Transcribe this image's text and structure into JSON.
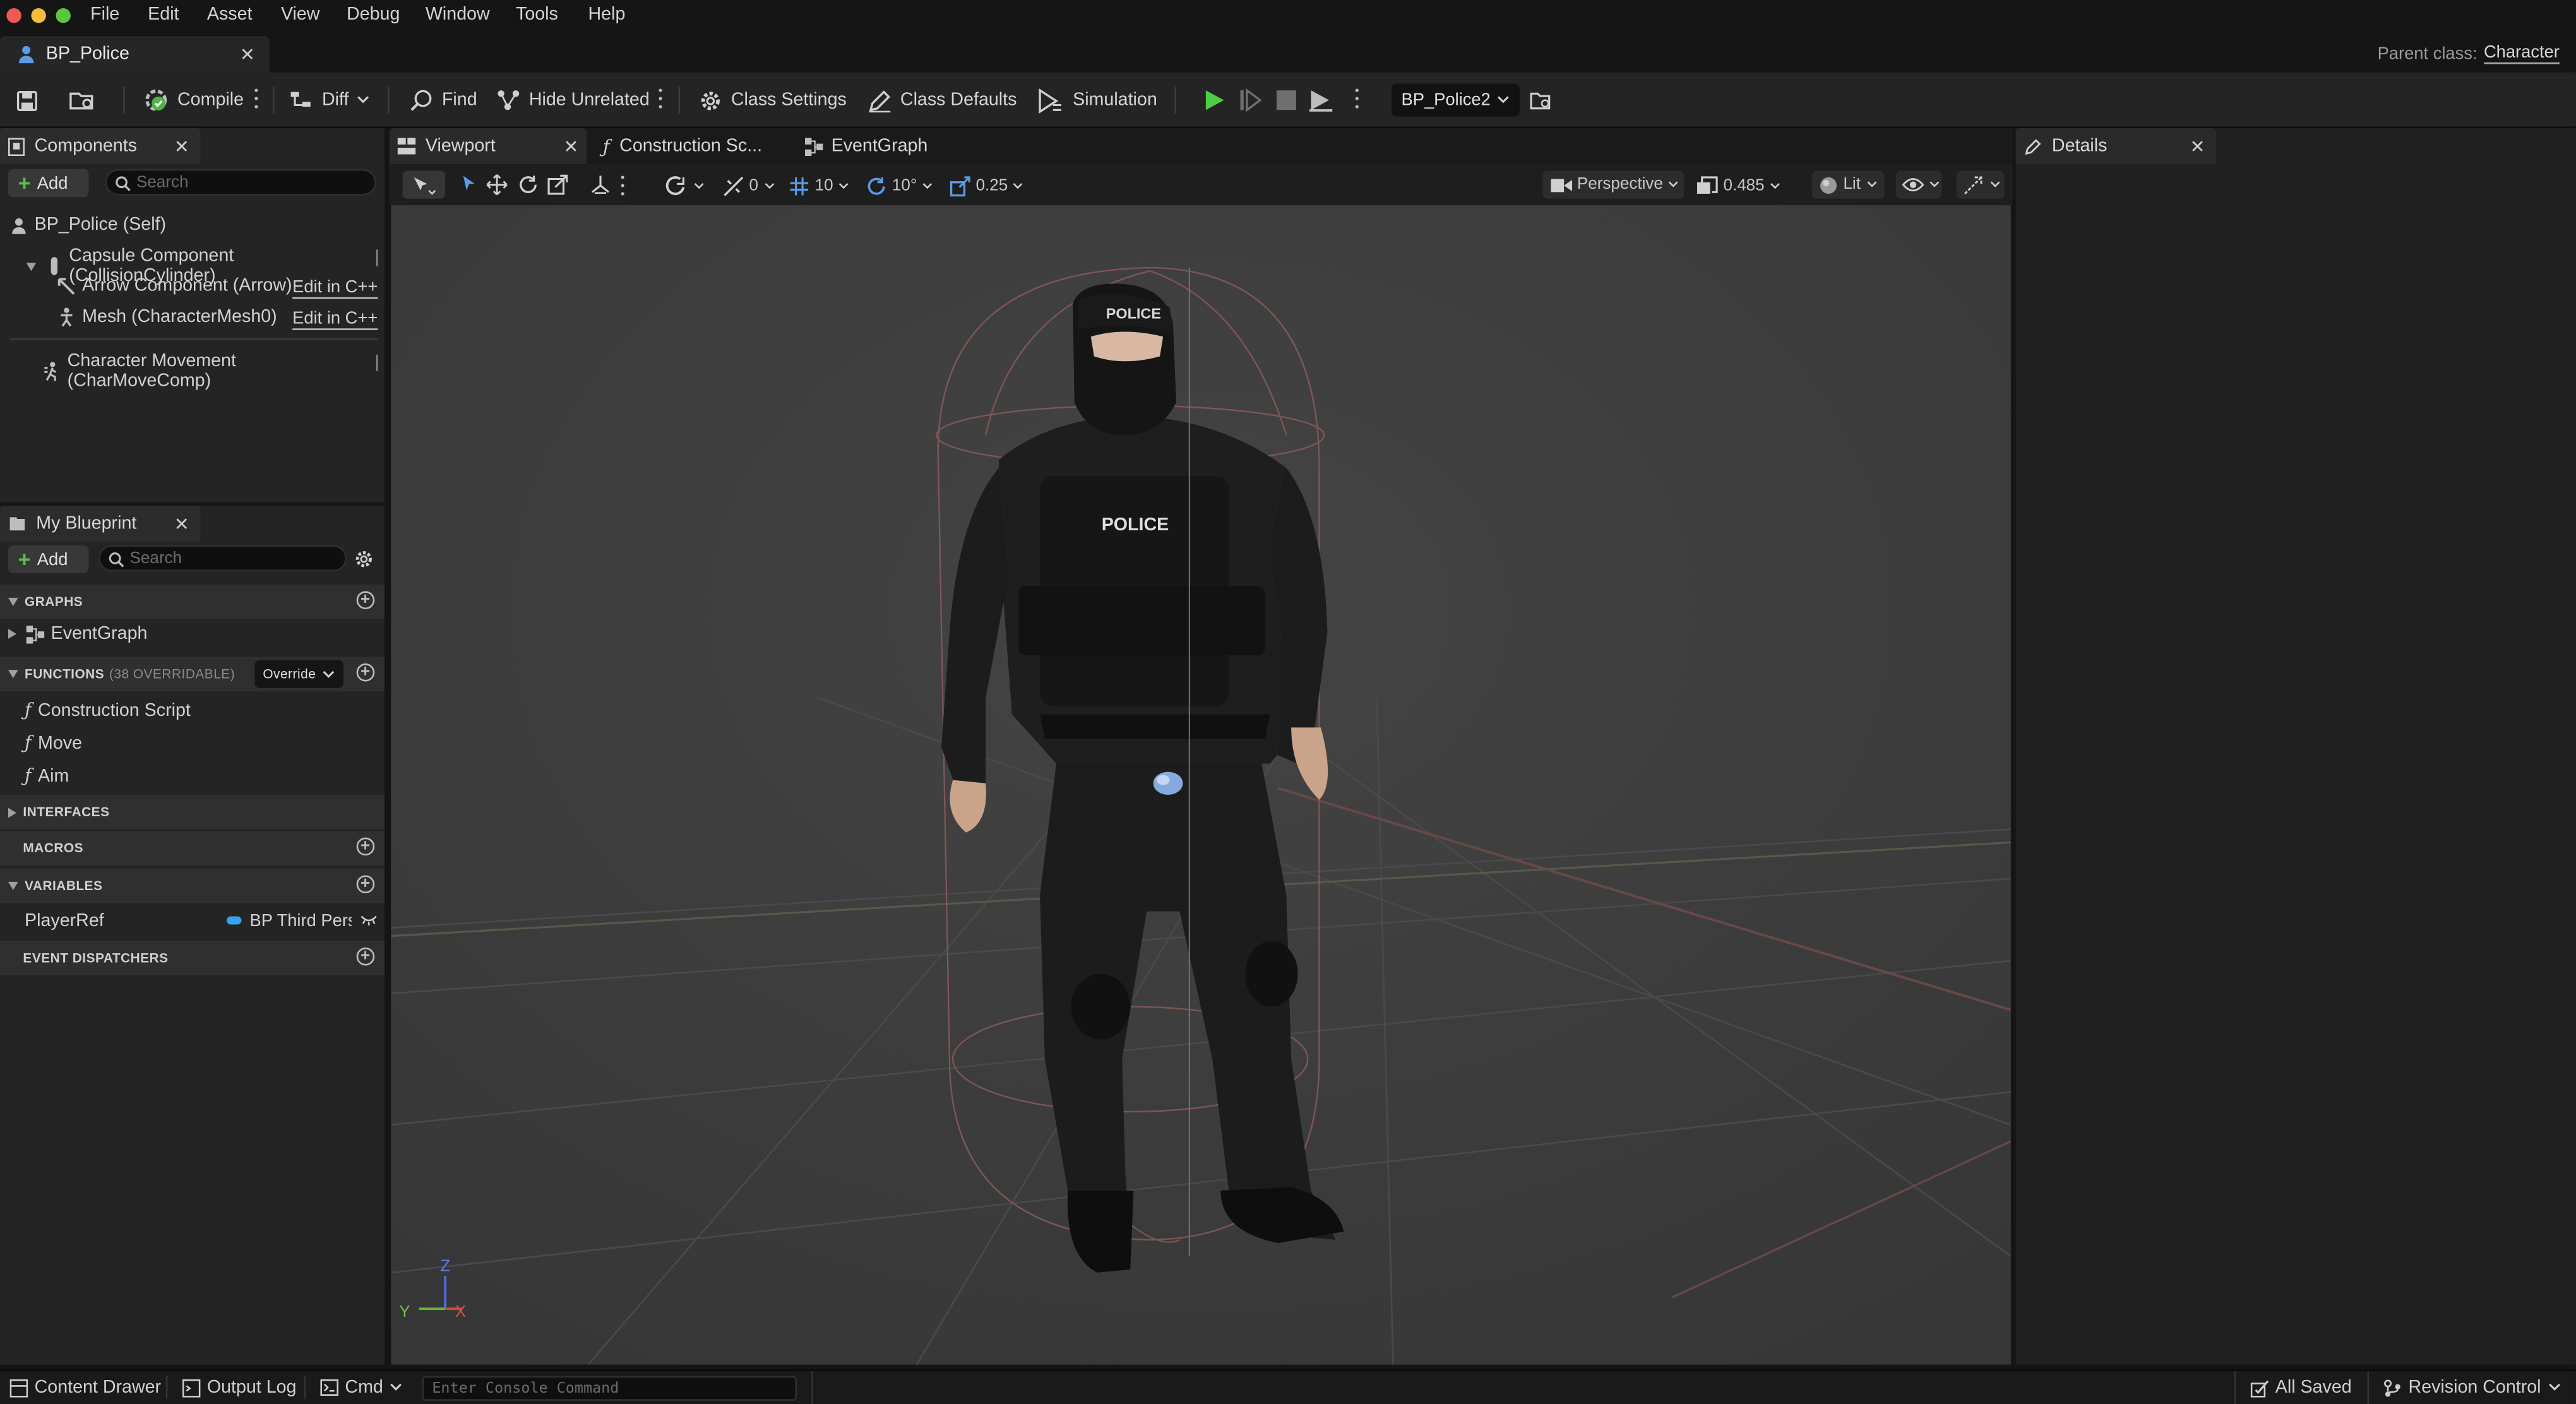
{
  "menu": [
    "File",
    "Edit",
    "Asset",
    "View",
    "Debug",
    "Window",
    "Tools",
    "Help"
  ],
  "document_tab": {
    "title": "BP_Police"
  },
  "parent_class": {
    "label": "Parent class:",
    "value": "Character"
  },
  "toolbar": {
    "compile": "Compile",
    "diff": "Diff",
    "find": "Find",
    "hide_unrelated": "Hide Unrelated",
    "class_settings": "Class Settings",
    "class_defaults": "Class Defaults",
    "simulation": "Simulation",
    "debug_object": "BP_Police2"
  },
  "components_panel": {
    "title": "Components",
    "add_label": "Add",
    "search_placeholder": "Search",
    "items": [
      {
        "label": "BP_Police (Self)"
      },
      {
        "label": "Capsule Component (CollisionCylinder)"
      },
      {
        "label": "Arrow Component (Arrow)",
        "action": "Edit in C++"
      },
      {
        "label": "Mesh (CharacterMesh0)",
        "action": "Edit in C++"
      },
      {
        "label": "Character Movement (CharMoveComp)"
      }
    ]
  },
  "my_blueprint": {
    "title": "My Blueprint",
    "add_label": "Add",
    "search_placeholder": "Search",
    "sections": {
      "graphs": "GRAPHS",
      "functions": "FUNCTIONS",
      "functions_count": "(38 OVERRIDABLE)",
      "override_label": "Override",
      "interfaces": "INTERFACES",
      "macros": "MACROS",
      "variables": "VARIABLES",
      "event_dispatchers": "EVENT DISPATCHERS"
    },
    "graphs": [
      "EventGraph"
    ],
    "functions": [
      "Construction Script",
      "Move",
      "Aim"
    ],
    "variables": [
      {
        "name": "PlayerRef",
        "type": "BP Third Pers"
      }
    ]
  },
  "editor_tabs": [
    "Viewport",
    "Construction Sc...",
    "EventGraph"
  ],
  "viewport_toolbar": {
    "rotate_snap": "0",
    "grid_snap": "10",
    "angle_snap": "10°",
    "scale_snap": "0.25",
    "view_mode": "Perspective",
    "camera_speed": "0.485",
    "lighting": "Lit"
  },
  "viewport": {
    "vest_label": "POLICE",
    "cap_label": "POLICE",
    "axis_z": "Z",
    "axis_y": "Y",
    "axis_x": "X"
  },
  "details_panel": {
    "title": "Details"
  },
  "status_bar": {
    "content_drawer": "Content Drawer",
    "output_log": "Output Log",
    "cmd": "Cmd",
    "console_placeholder": "Enter Console Command",
    "all_saved": "All Saved",
    "revision_control": "Revision Control"
  },
  "colors": {
    "accent_blue": "#4d8ee0",
    "play_green": "#4fcc46",
    "add_green": "#5cc14f",
    "variable_pin": "#3aa0f0"
  }
}
